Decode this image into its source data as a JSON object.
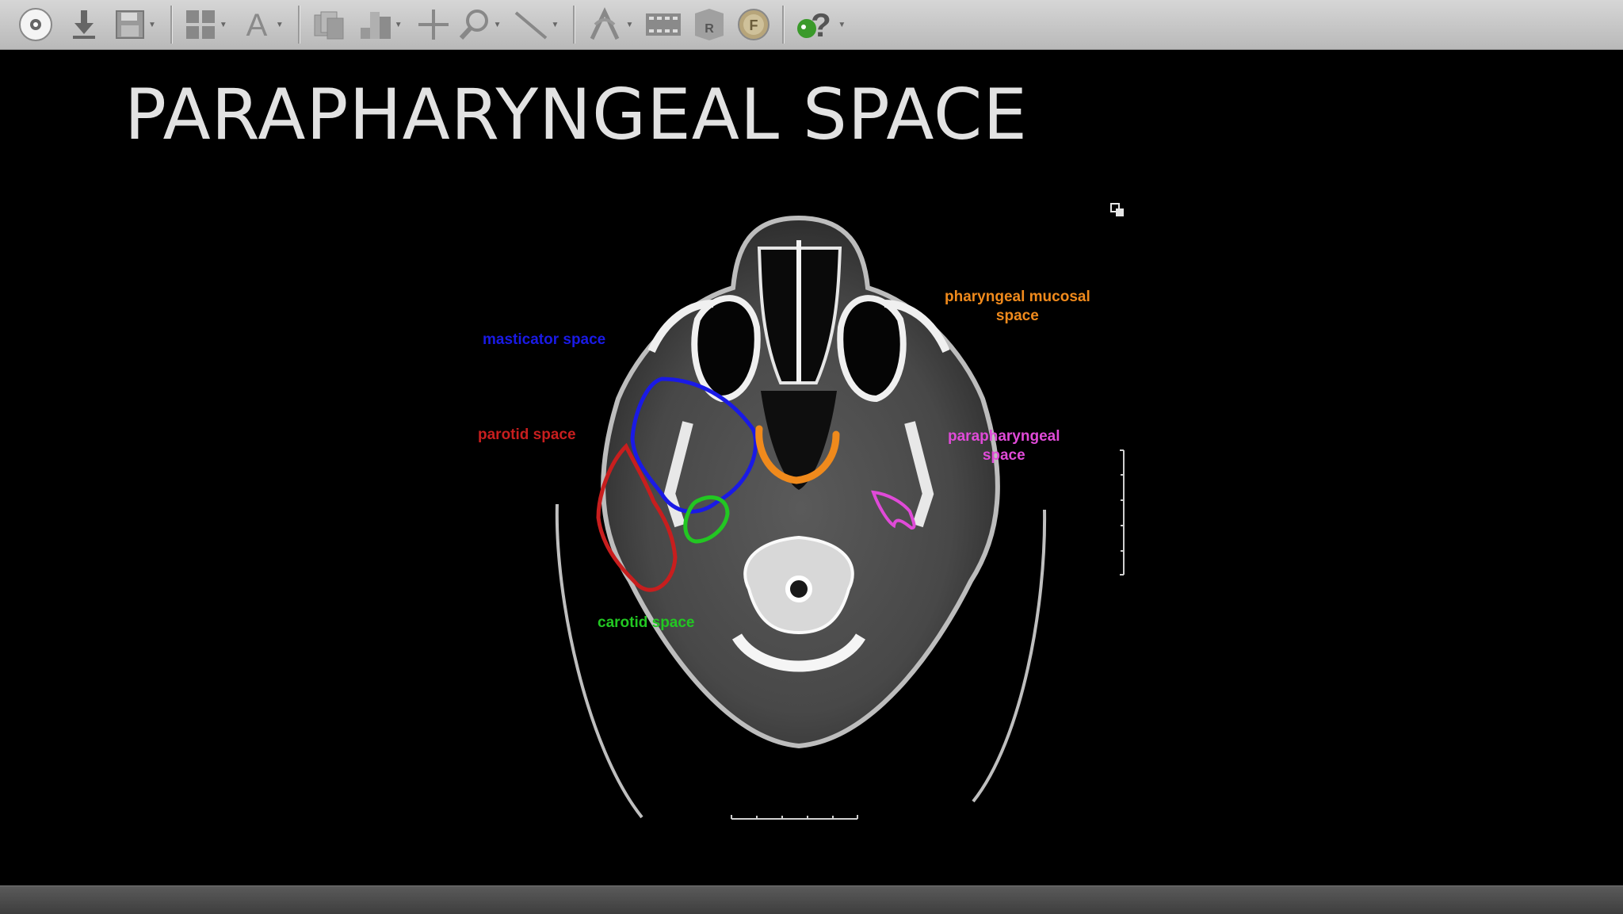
{
  "toolbar": {
    "buttons": [
      {
        "name": "cd-dvd-icon",
        "label": "CD DVD"
      },
      {
        "name": "import-icon"
      },
      {
        "name": "save-icon"
      },
      {
        "name": "layout-grid-icon"
      },
      {
        "name": "text-annotation-icon",
        "label": "A"
      },
      {
        "name": "series-stack-icon"
      },
      {
        "name": "window-level-icon"
      },
      {
        "name": "pan-crosshair-icon"
      },
      {
        "name": "zoom-icon"
      },
      {
        "name": "measure-ruler-icon"
      },
      {
        "name": "reference-lines-icon"
      },
      {
        "name": "cine-film-icon"
      },
      {
        "name": "mpr-3d-icon",
        "label": "R"
      },
      {
        "name": "fusion-icon",
        "label": "F"
      },
      {
        "name": "help-icon",
        "label": "?"
      }
    ]
  },
  "slide": {
    "title": "PARAPHARYNGEAL SPACE"
  },
  "labels": {
    "masticator": "masticator space",
    "parotid": "parotid space",
    "carotid": "carotid space",
    "pharyngeal_mucosal_line1": "pharyngeal mucosal",
    "pharyngeal_mucosal_line2": "space",
    "parapharyngeal_line1": "parapharyngeal",
    "parapharyngeal_line2": "space"
  },
  "colors": {
    "masticator": "#1a1ae6",
    "parotid": "#c81e1e",
    "carotid": "#22c722",
    "pharyngeal_mucosal": "#f08a1c",
    "parapharyngeal": "#e04ad8",
    "title": "#e2e2e2",
    "toolbar_bg": "#c8c8c8"
  }
}
